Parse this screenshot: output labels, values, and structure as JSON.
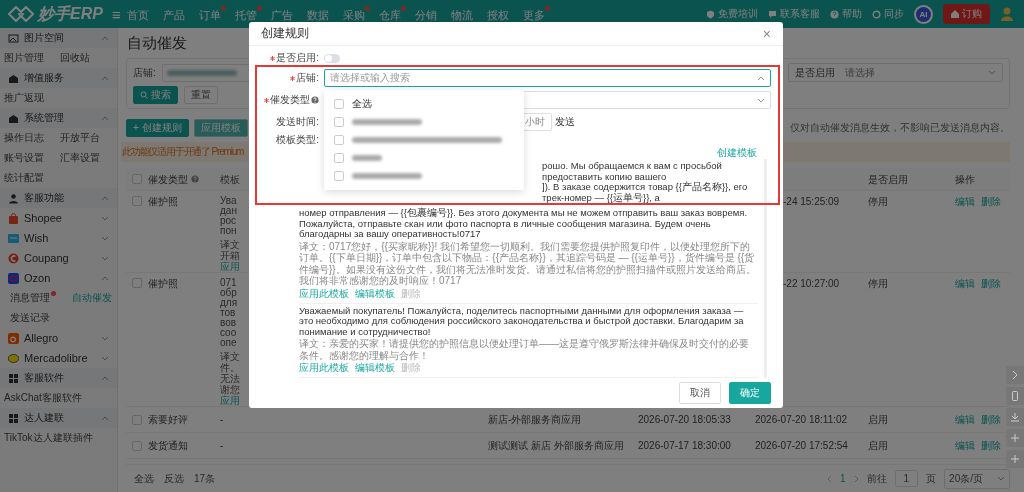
{
  "topbar": {
    "logo": "妙手ERP",
    "menu": "≡",
    "nav": [
      {
        "label": "首页",
        "dot": false
      },
      {
        "label": "产品",
        "dot": false
      },
      {
        "label": "订单",
        "dot": true
      },
      {
        "label": "托管",
        "dot": true
      },
      {
        "label": "广告",
        "dot": false
      },
      {
        "label": "数据",
        "dot": false
      },
      {
        "label": "采购",
        "dot": true
      },
      {
        "label": "仓库",
        "dot": true
      },
      {
        "label": "分销",
        "dot": false
      },
      {
        "label": "物流",
        "dot": false
      },
      {
        "label": "授权",
        "dot": false
      },
      {
        "label": "更多",
        "dot": true
      }
    ],
    "links": [
      {
        "label": "免费培训"
      },
      {
        "label": "联系客服"
      },
      {
        "label": "帮助"
      },
      {
        "label": "同步"
      }
    ],
    "avatar": "AI",
    "order_button": "订购"
  },
  "sidebar": {
    "items": [
      {
        "kind": "group",
        "label": "图片空间",
        "expanded": true
      },
      {
        "kind": "links",
        "links": [
          {
            "label": "图片管理",
            "selected": false,
            "dot": false
          },
          {
            "label": "回收站",
            "selected": false,
            "dot": false
          }
        ]
      },
      {
        "kind": "group",
        "label": "增值服务",
        "expanded": true
      },
      {
        "kind": "links",
        "links": [
          {
            "label": "推广返现",
            "selected": false,
            "dot": false
          }
        ]
      },
      {
        "kind": "group",
        "label": "系统管理",
        "expanded": true
      },
      {
        "kind": "links",
        "links": [
          {
            "label": "操作日志",
            "selected": false,
            "dot": false
          },
          {
            "label": "开放平台",
            "selected": false,
            "dot": false
          }
        ]
      },
      {
        "kind": "links",
        "links": [
          {
            "label": "账号设置",
            "selected": false,
            "dot": false
          },
          {
            "label": "汇率设置",
            "selected": false,
            "dot": false
          }
        ]
      },
      {
        "kind": "links",
        "links": [
          {
            "label": "统计配置",
            "selected": false,
            "dot": false
          }
        ]
      },
      {
        "kind": "group",
        "label": "客服功能",
        "expanded": true
      },
      {
        "kind": "platform",
        "label": "Shopee",
        "expanded": false
      },
      {
        "kind": "platform",
        "label": "Wish",
        "expanded": false
      },
      {
        "kind": "platform",
        "label": "Coupang",
        "expanded": false
      },
      {
        "kind": "platform",
        "label": "Ozon",
        "expanded": true
      },
      {
        "kind": "sublinks",
        "links": [
          {
            "label": "消息管理",
            "selected": false,
            "dot": true
          },
          {
            "label": "自动催发",
            "selected": true,
            "dot": false
          }
        ]
      },
      {
        "kind": "sublinks",
        "links": [
          {
            "label": "发送记录",
            "selected": false,
            "dot": false
          }
        ]
      },
      {
        "kind": "platform",
        "label": "Allegro",
        "expanded": false
      },
      {
        "kind": "platform",
        "label": "Mercadolibre",
        "expanded": false
      },
      {
        "kind": "group",
        "label": "客服软件",
        "expanded": true
      },
      {
        "kind": "links",
        "links": [
          {
            "label": "AskChat客服软件",
            "selected": false,
            "dot": false
          }
        ]
      },
      {
        "kind": "group",
        "label": "达人建联",
        "expanded": true
      },
      {
        "kind": "links",
        "links": [
          {
            "label": "TikTok达人建联插件",
            "selected": false,
            "dot": false
          }
        ]
      }
    ]
  },
  "main": {
    "title": "自动催发",
    "filter": {
      "store_label": "店铺:",
      "enabled_label": "是否启用",
      "enabled_placeholder": "请选择",
      "search": "搜索",
      "reset": "重置"
    },
    "toolbar": {
      "create": "+ 创建规则",
      "apply": "应用模板",
      "apply_disabled": true,
      "hint": "仅对自动催发消息生效，不影响已发送消息内容。"
    },
    "notice": "此功能仅适用于开通了 Premium",
    "table": {
      "select_all_checked": false,
      "columns": {
        "type": "催发类型",
        "template": "模板",
        "status": "是否启用",
        "actions": "操作"
      },
      "rows": [
        {
          "kind": "tall",
          "checked": false,
          "type": "催护照",
          "template_lines": [
            "Ува",
            "дан",
            "рос",
            "пон"
          ],
          "translation_lines": [
            "译文",
            "开箱"
          ],
          "link": "应用",
          "updated": "-24 15:25:09",
          "status": "停用",
          "actions": [
            "编辑",
            "删除"
          ]
        },
        {
          "kind": "tall",
          "checked": false,
          "type": "催护照",
          "template_lines": [
            "071",
            "обр",
            "для",
            "тов",
            "вов",
            "соо",
            "опе"
          ],
          "translation_lines": [
            "译文",
            "件。",
            "无法",
            "谢您"
          ],
          "link": "应用",
          "updated": "-22 10:27:00",
          "status": "停用",
          "actions": [
            "编辑",
            "删除"
          ]
        },
        {
          "kind": "plain",
          "checked": false,
          "type": "索要好评",
          "template": "-",
          "store": "新店-外部服务商应用",
          "created": "2026-07-20 18:05:33",
          "updated": "2026-07-20 18:11:02",
          "status": "启用",
          "actions": [
            "编辑",
            "删除"
          ]
        },
        {
          "kind": "plain",
          "checked": false,
          "type": "发货通知",
          "template": "-",
          "store": "测试测试 新店 外部服务商应用",
          "created": "2026-07-17 18:30:00",
          "updated": "2026-07-20 17:52:54",
          "status": "启用",
          "actions": [
            "编辑",
            "删除"
          ]
        }
      ]
    },
    "footer": {
      "select_all": "全选",
      "invert": "反选",
      "count": "17条",
      "page": "1",
      "goto": "前往",
      "page_input": "1",
      "page_unit": "页",
      "page_size": "20条/页"
    }
  },
  "modal": {
    "title": "创建规则",
    "close": "×",
    "highlight_frame": true,
    "fields": [
      {
        "kind": "switch",
        "label": "是否启用:",
        "required": true,
        "on": false
      },
      {
        "kind": "store_select",
        "label": "店铺:",
        "required": true,
        "placeholder": "请选择或输入搜索",
        "expanded": true
      },
      {
        "kind": "select",
        "label": "催发类型",
        "required": true,
        "help": true,
        "expanded": false
      },
      {
        "kind": "hours",
        "label": "发送时间:",
        "required": false,
        "suffix": "小时",
        "after": "发送"
      },
      {
        "kind": "blank",
        "label": "模板类型:",
        "required": false
      }
    ],
    "dropdown": [
      {
        "kind": "text",
        "label": "全选",
        "checked": false
      },
      {
        "kind": "redacted",
        "checked": false
      },
      {
        "kind": "redacted",
        "checked": false
      },
      {
        "kind": "redacted",
        "checked": false
      },
      {
        "kind": "redacted",
        "checked": false
      }
    ],
    "create_template": "创建模板",
    "templates": [
      {
        "covered_lines": [
          "рошо. Мы обращаемся к вам с просьбой предоставить копию вашего",
          "]). В заказе содержится товар {{产品名称}}, его трек-номер — {{运单号}}, а"
        ],
        "text": "номер отправления — {{包裹编号}}. Без этого документа мы не можем отправить ваш заказ вовремя. Пожалуйста, отправьте скан или фото паспорта в личные сообщения магазина. Будем очень благодарны за вашу оперативность!0717",
        "translation": "译文：0717您好，{{买家昵称}}! 我们希望您一切顺利。我们需要您提供护照复印件，以便处理您所下的订单。{{下单日期}}，订单中包含以下物品：{{产品名称}}，其追踪号码是 — {{运单号}}，货件编号是 {{货件编号}}。如果没有这份文件，我们将无法准时发货。请通过私信将您的护照扫描件或照片发送给商店。我们将非常感谢您的及时响应！0717",
        "actions": [
          {
            "kind": "link",
            "label": "应用此模板"
          },
          {
            "kind": "link",
            "label": "编辑模板"
          },
          {
            "kind": "muted",
            "label": "删除"
          }
        ]
      },
      {
        "text": "Уважаемый покупатель! Пожалуйста, поделитесь паспортными данными для оформления заказа — это необходимо для соблюдения российского законодательства и быстрой доставки. Благодарим за понимание и сотрудничество!",
        "translation": "译文：亲爱的买家！请提供您的护照信息以便处理订单——这是遵守俄罗斯法律并确保及时交付的必要条件。感谢您的理解与合作！",
        "actions": [
          {
            "kind": "link",
            "label": "应用此模板"
          },
          {
            "kind": "link",
            "label": "编辑模板"
          },
          {
            "kind": "muted",
            "label": "删除"
          }
        ]
      }
    ],
    "cancel": "取消",
    "ok": "确定"
  }
}
